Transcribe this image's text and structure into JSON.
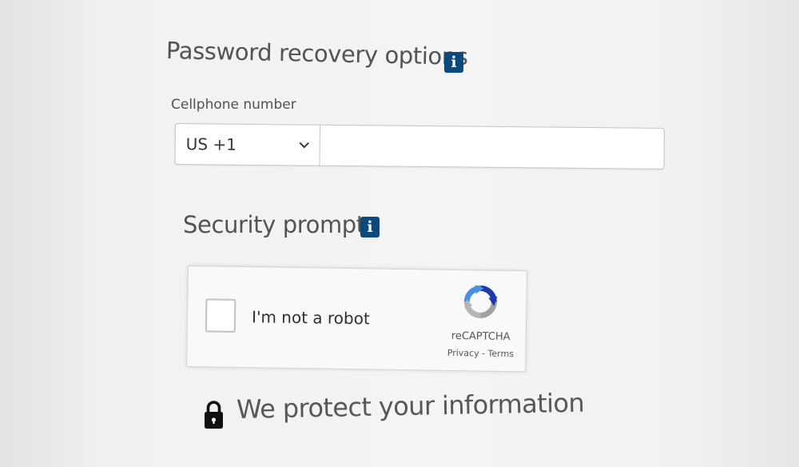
{
  "recovery": {
    "title": "Password recovery options",
    "info_icon": "i",
    "cellphone_label": "Cellphone number",
    "country_code_value": "US +1",
    "phone_value": "",
    "phone_placeholder": ""
  },
  "security": {
    "title": "Security prompt",
    "info_icon": "i"
  },
  "captcha": {
    "label": "I'm not a robot",
    "checked": false,
    "brand": "reCAPTCHA",
    "privacy_link": "Privacy",
    "separator": " - ",
    "terms_link": "Terms"
  },
  "footer": {
    "protect_text": "We protect your information",
    "icon": "lock-icon"
  },
  "colors": {
    "info_badge": "#0d4a7c",
    "heading_text": "#505457",
    "background": "#f4f4f4"
  }
}
